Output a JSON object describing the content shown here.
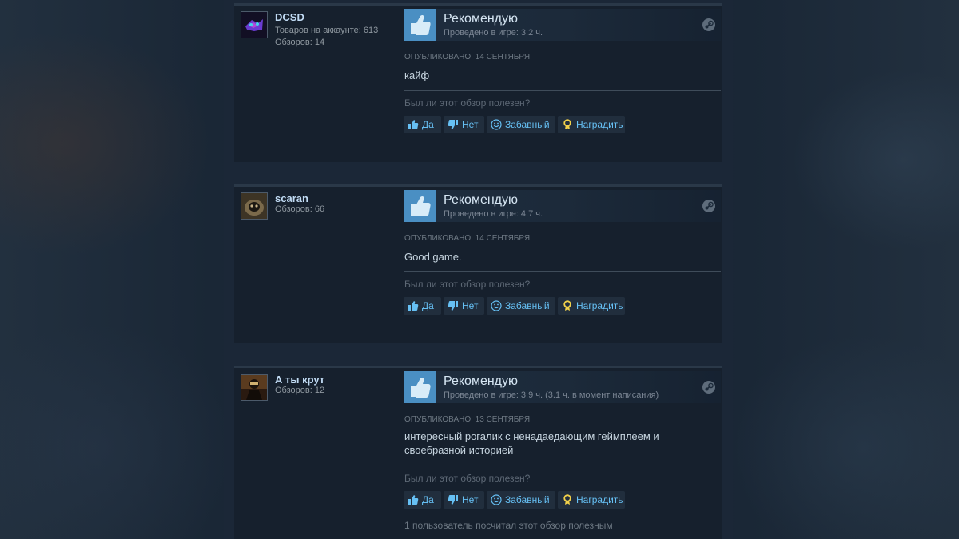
{
  "colors": {
    "accent": "#66c0f4",
    "thumb_bg": "#4a8fc3",
    "award": "#f2d14a"
  },
  "labels": {
    "question": "Был ли этот обзор полезен?",
    "yes": "Да",
    "no": "Нет",
    "funny": "Забавный",
    "award": "Наградить"
  },
  "reviews": [
    {
      "username": "DCSD",
      "meta_lines": [
        "Товаров на аккаунте: 613",
        "Обзоров: 14"
      ],
      "verdict": "Рекомендую",
      "hours": "Проведено в игре: 3.2 ч.",
      "posted": "Опубликовано: 14 сентября",
      "text": "кайф",
      "icons": {
        "thumb": "thumbs-up-icon",
        "platform": "steam-icon"
      }
    },
    {
      "username": "scaran",
      "meta_lines": [
        "Обзоров: 66"
      ],
      "verdict": "Рекомендую",
      "hours": "Проведено в игре: 4.7 ч.",
      "posted": "Опубликовано: 14 сентября",
      "text": "Good game.",
      "icons": {
        "thumb": "thumbs-up-icon",
        "platform": "steam-icon"
      }
    },
    {
      "username": "А ты крут",
      "meta_lines": [
        "Обзоров: 12"
      ],
      "verdict": "Рекомендую",
      "hours": "Проведено в игре: 3.9 ч. (3.1 ч. в момент написания)",
      "posted": "Опубликовано: 13 сентября",
      "text": "интересный рогалик с ненадаедающим геймплеем и своебразной историей",
      "helpful_count": "1 пользователь посчитал этот обзор полезным",
      "icons": {
        "thumb": "thumbs-up-icon",
        "platform": "steam-icon"
      }
    }
  ]
}
